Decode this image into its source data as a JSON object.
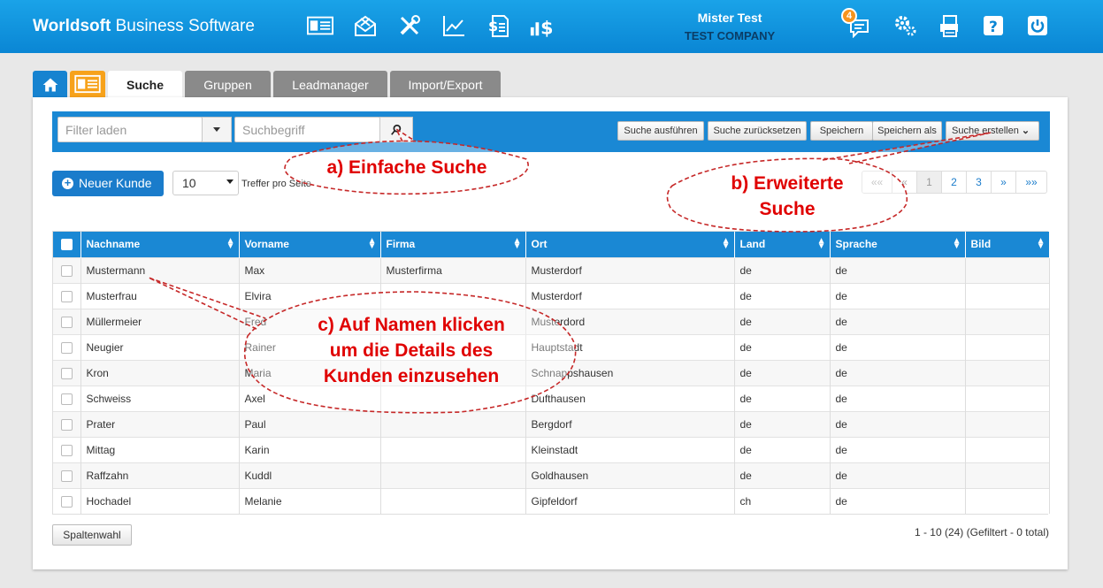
{
  "header": {
    "brand_bold": "Worldsoft",
    "brand_rest": " Business Software",
    "user_name": "Mister Test",
    "company": "TEST COMPANY",
    "notification_count": "4",
    "icons": [
      "contact-card-icon",
      "mail-icon",
      "tools-icon",
      "chart-icon",
      "invoice-icon",
      "sales-icon",
      "messages-icon",
      "settings-icon",
      "printer-icon",
      "help-icon",
      "power-icon"
    ]
  },
  "tabs": [
    {
      "label": "",
      "icon": "home-icon"
    },
    {
      "label": "",
      "icon": "contact-card-icon"
    },
    {
      "label": "Suche"
    },
    {
      "label": "Gruppen"
    },
    {
      "label": "Leadmanager"
    },
    {
      "label": "Import/Export"
    }
  ],
  "search": {
    "filter_placeholder": "Filter laden",
    "term_placeholder": "Suchbegriff",
    "execute": "Suche ausführen",
    "reset": "Suche zurücksetzen",
    "save": "Speichern",
    "save_as": "Speichern als",
    "create": "Suche erstellen"
  },
  "list": {
    "new_customer": "Neuer Kunde",
    "per_page_value": "10",
    "per_page_label": "Treffer pro Seite",
    "pager": [
      "««",
      "«",
      "1",
      "2",
      "3",
      "»",
      "»»"
    ],
    "columns": [
      "Nachname",
      "Vorname",
      "Firma",
      "Ort",
      "Land",
      "Sprache",
      "Bild"
    ],
    "rows": [
      [
        "Mustermann",
        "Max",
        "Musterfirma",
        "Musterdorf",
        "de",
        "de",
        ""
      ],
      [
        "Musterfrau",
        "Elvira",
        "",
        "Musterdorf",
        "de",
        "de",
        ""
      ],
      [
        "Müllermeier",
        "Fred",
        "",
        "Musterdord",
        "de",
        "de",
        ""
      ],
      [
        "Neugier",
        "Rainer",
        "",
        "Hauptstadt",
        "de",
        "de",
        ""
      ],
      [
        "Kron",
        "Maria",
        "",
        "Schnappshausen",
        "de",
        "de",
        ""
      ],
      [
        "Schweiss",
        "Axel",
        "",
        "Dufthausen",
        "de",
        "de",
        ""
      ],
      [
        "Prater",
        "Paul",
        "",
        "Bergdorf",
        "de",
        "de",
        ""
      ],
      [
        "Mittag",
        "Karin",
        "",
        "Kleinstadt",
        "de",
        "de",
        ""
      ],
      [
        "Raffzahn",
        "Kuddl",
        "",
        "Goldhausen",
        "de",
        "de",
        ""
      ],
      [
        "Hochadel",
        "Melanie",
        "",
        "Gipfeldorf",
        "ch",
        "de",
        ""
      ]
    ],
    "column_select": "Spaltenwahl",
    "info": "1 - 10 (24) (Gefiltert - 0 total)"
  },
  "annotations": {
    "a": "a) Einfache Suche",
    "b1": "b) Erweiterte",
    "b2": "Suche",
    "c1": "c) Auf Namen klicken",
    "c2": "um die Details des",
    "c3": "Kunden einzusehen"
  },
  "colors": {
    "header_blue": "#0a86d4",
    "accent_blue": "#1a88d4",
    "badge_orange": "#f7941d",
    "annotation_red": "#e00000"
  }
}
